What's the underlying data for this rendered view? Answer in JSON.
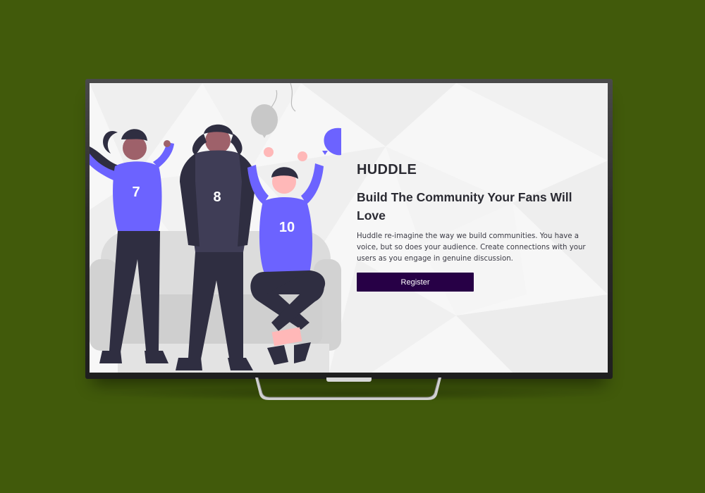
{
  "page": {
    "background": "#415a0b"
  },
  "hero": {
    "brand": "HUDDLE",
    "headline": "Build The Community Your Fans Will Love",
    "description": "Huddle re-imagine the way we build communities. You have a voice, but so does your audience. Create connections with your users as you engage in genuine discussion.",
    "register_label": "Register",
    "button_color": "#270046"
  },
  "illustration": {
    "jersey_numbers": [
      "7",
      "8",
      "10"
    ],
    "accent_color": "#6c63ff"
  }
}
